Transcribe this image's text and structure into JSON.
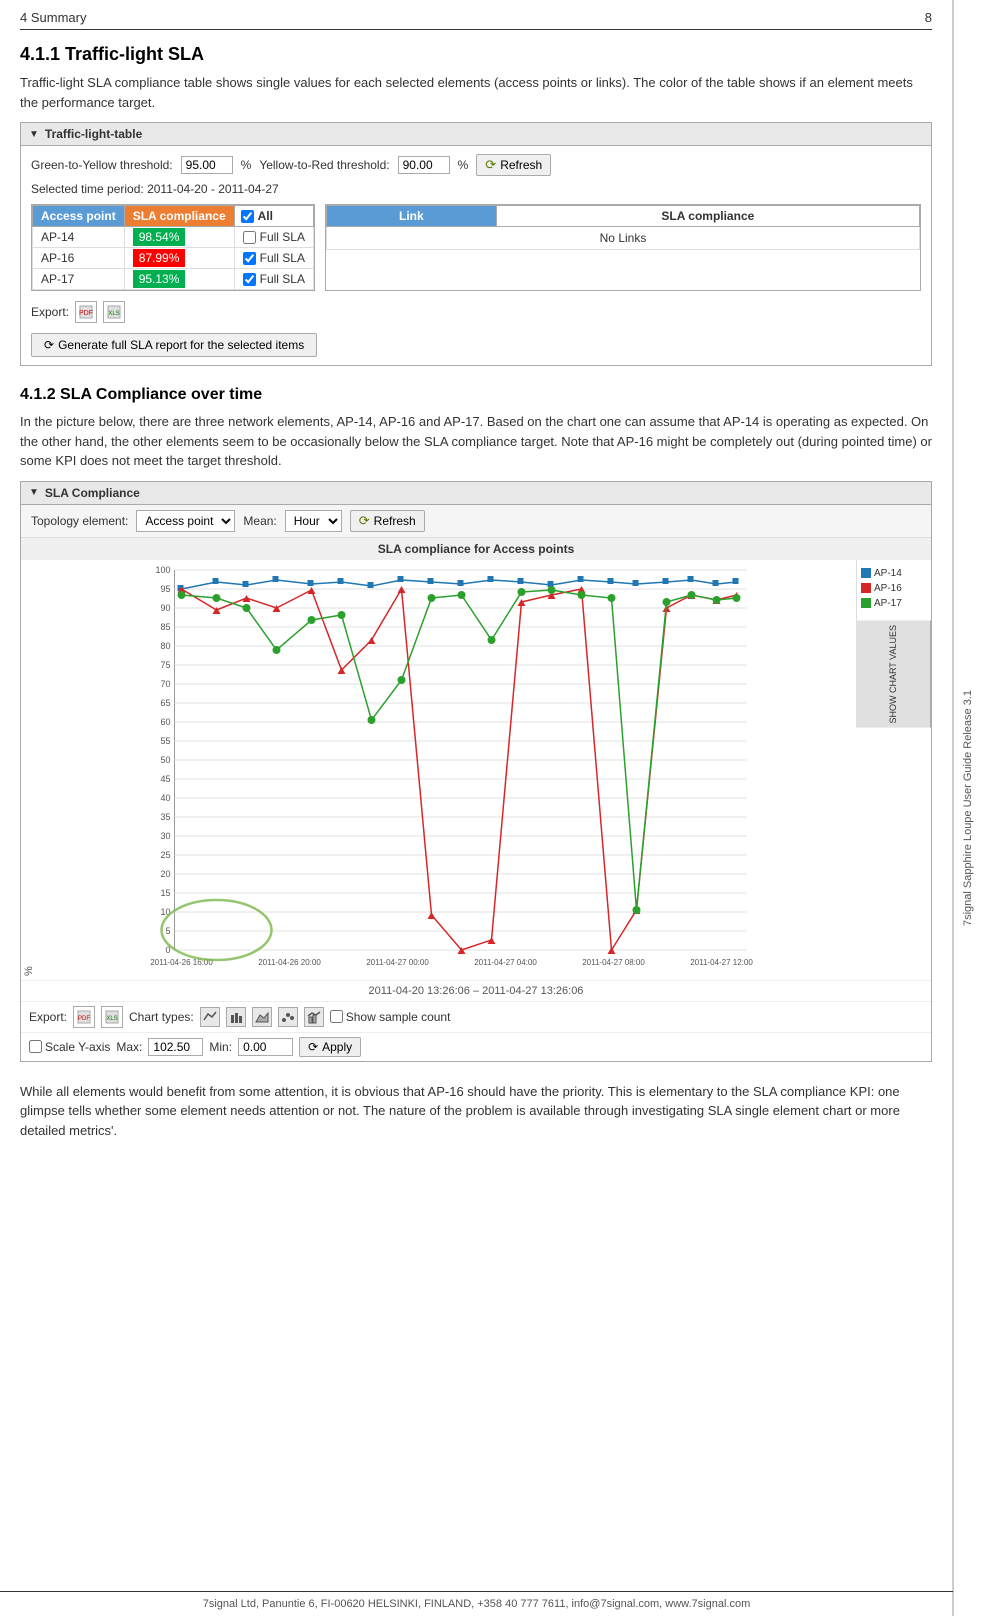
{
  "header": {
    "left": "4 Summary",
    "right": "8"
  },
  "sidebar": {
    "text": "7signal Sapphire Loupe User Guide Release 3.1"
  },
  "section1": {
    "title": "4.1.1 Traffic-light SLA",
    "description": "Traffic-light SLA compliance table shows single values for each selected elements (access points or links). The color of the table shows if an element meets the performance target."
  },
  "traffic_widget": {
    "title": "Traffic-light-table",
    "green_yellow_label": "Green-to-Yellow threshold:",
    "green_yellow_value": "95.00",
    "percent1": "%",
    "yellow_red_label": "Yellow-to-Red threshold:",
    "yellow_red_value": "90.00",
    "percent2": "%",
    "refresh_label": "Refresh",
    "selected_period_label": "Selected time period:",
    "selected_period_value": "2011-04-20 - 2011-04-27",
    "table_headers": {
      "access_point": "Access point",
      "sla_compliance": "SLA compliance",
      "all": "All",
      "link": "Link",
      "link_sla": "SLA compliance"
    },
    "rows": [
      {
        "ap": "AP-14",
        "sla": "98.54%",
        "color": "green",
        "checkbox": "Full SLA"
      },
      {
        "ap": "AP-16",
        "sla": "87.99%",
        "color": "red",
        "checkbox": "Full SLA"
      },
      {
        "ap": "AP-17",
        "sla": "95.13%",
        "color": "green",
        "checkbox": "Full SLA"
      }
    ],
    "no_links": "No Links",
    "export_label": "Export:",
    "generate_btn": "Generate full SLA report for the selected items"
  },
  "section2": {
    "title": "4.1.2 SLA Compliance over time",
    "description1": "In the picture below, there are three network elements, AP-14, AP-16 and AP-17. Based on the chart one can assume that AP-14 is operating as expected. On the other hand, the other elements seem to be occasionally below the SLA compliance target. Note that AP-16 might be completely out (during pointed time) or some KPI does not meet the target threshold."
  },
  "sla_compliance_widget": {
    "title": "SLA Compliance",
    "topology_label": "Topology element:",
    "topology_value": "Access point",
    "mean_label": "Mean:",
    "mean_value": "Hour",
    "refresh_label": "Refresh",
    "chart_title": "SLA compliance for Access points",
    "y_label": "%",
    "y_axis": [
      "100",
      "95",
      "90",
      "85",
      "80",
      "75",
      "70",
      "65",
      "60",
      "55",
      "50",
      "45",
      "40",
      "35",
      "30",
      "25",
      "20",
      "15",
      "10",
      "5",
      "0"
    ],
    "x_axis": [
      "2011-04-26 16:00",
      "2011-04-26 20:00",
      "2011-04-27 00:00",
      "2011-04-27 04:00",
      "2011-04-27 08:00",
      "2011-04-27 12:00"
    ],
    "time_range": "2011-04-20 13:26:06 – 2011-04-27 13:26:06",
    "legend": [
      {
        "label": "AP-14",
        "color": "#1f77b4",
        "shape": "square"
      },
      {
        "label": "AP-16",
        "color": "#d62728",
        "shape": "triangle"
      },
      {
        "label": "AP-17",
        "color": "#2ca02c",
        "shape": "circle"
      }
    ],
    "show_chart_values": "SHOW CHART VALUES",
    "export_label": "Export:",
    "chart_types_label": "Chart types:",
    "show_sample_count": "Show sample count",
    "scale_y_axis": "Scale Y-axis",
    "max_label": "Max:",
    "max_value": "102.50",
    "min_label": "Min:",
    "min_value": "0.00",
    "apply_label": "Apply"
  },
  "section3": {
    "description": "While all elements would benefit from some attention, it is obvious that AP-16 should have the priority. This is elementary to the SLA compliance KPI: one glimpse tells whether some element needs attention or not. The nature of the problem is available through investigating SLA single element chart or more detailed metrics'."
  },
  "footer": {
    "text": "7signal Ltd, Panuntie 6, FI-00620 HELSINKI, FINLAND, +358 40 777 7611, info@7signal.com, www.7signal.com"
  }
}
